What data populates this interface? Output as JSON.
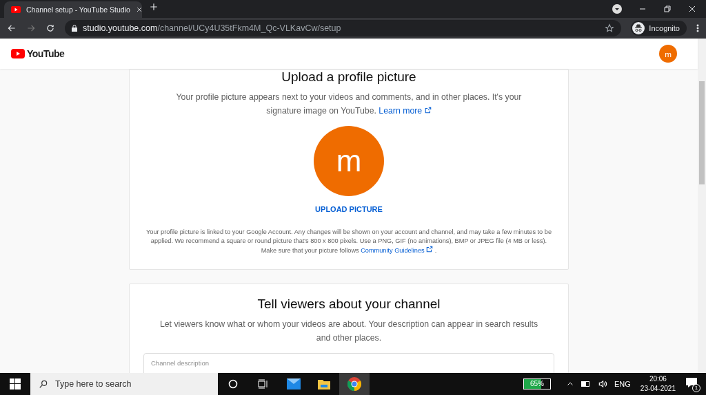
{
  "browser": {
    "tabs": [
      {
        "title": "Channel setup - YouTube Studio",
        "selected": true
      }
    ],
    "url": {
      "host": "studio.youtube.com",
      "path": "/channel/UCy4U35tFkm4M_Qc-VLKavCw/setup"
    },
    "profile": "Incognito"
  },
  "header": {
    "logo": "YouTube",
    "avatar": "m"
  },
  "profile_card": {
    "title": "Upload a profile picture",
    "description": "Your profile picture appears next to your videos and comments, and in other places. It's your signature image on YouTube.",
    "link": "Learn more",
    "avatar": "m",
    "button": "UPLOAD PICTURE",
    "note": "Your profile picture is linked to your Google Account. Any changes will be shown on your account and channel, and may take a few minutes to be applied. We recommend a square or round picture that's 800 x 800 pixels. Use a PNG, GIF (no animations), BMP or JPEG file (4 MB or less). Make sure that your picture follows",
    "note_link": "Community Guidelines",
    "note_end": "."
  },
  "about_card": {
    "title": "Tell viewers about your channel",
    "description": "Let viewers know what or whom your videos are about. Your description can appear in search results and other places.",
    "field": {
      "placeholder": "Channel description"
    }
  },
  "taskbar": {
    "search": {
      "placeholder": "Type here to search"
    },
    "battery": {
      "reading": "65%",
      "level": 0.65
    },
    "language": "ENG",
    "time": "20:06",
    "date": "23-04-2021",
    "notifications": "1"
  }
}
